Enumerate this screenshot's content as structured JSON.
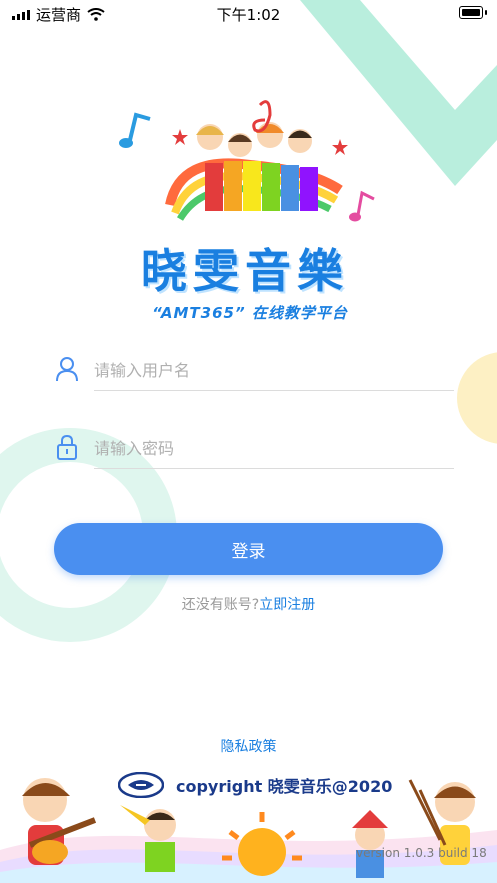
{
  "status_bar": {
    "carrier": "运营商",
    "time": "下午1:02"
  },
  "logo": {
    "title": "晓雯音樂",
    "subtitle": "“AMT365” 在线教学平台"
  },
  "form": {
    "username_placeholder": "请输入用户名",
    "password_placeholder": "请输入密码",
    "login_label": "登录",
    "no_account_text": "还没有账号?",
    "register_label": "立即注册"
  },
  "footer": {
    "privacy_label": "隐私政策",
    "copyright": "copyright  晓雯音乐@2020",
    "version": "version 1.0.3 build 18"
  },
  "colors": {
    "accent": "#4a8ff0",
    "link": "#1a7fe0",
    "mint": "#b9eedd",
    "yellow": "#fdf0c4"
  },
  "icons": [
    "wifi-icon",
    "battery-icon",
    "user-icon",
    "lock-icon",
    "school-emblem-icon"
  ]
}
